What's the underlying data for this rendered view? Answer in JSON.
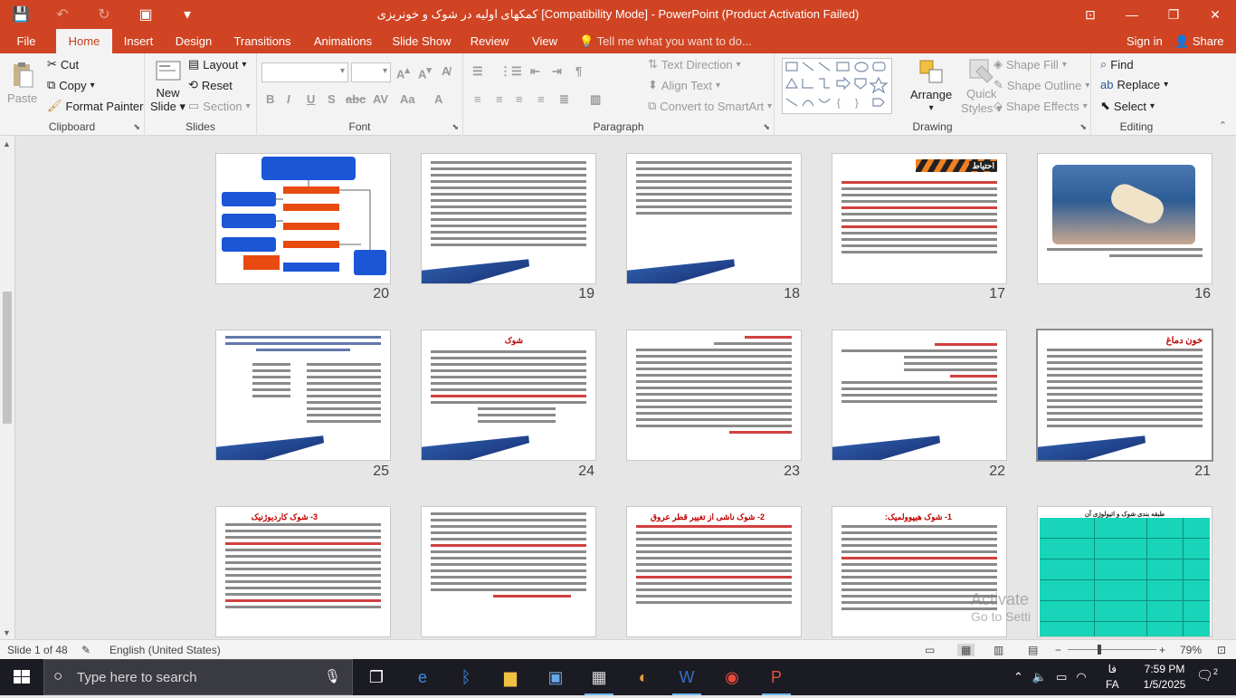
{
  "window": {
    "title": "کمکهای اولیه در شوک و خونریزی [Compatibility Mode] - PowerPoint (Product Activation Failed)"
  },
  "tabs": [
    "File",
    "Home",
    "Insert",
    "Design",
    "Transitions",
    "Animations",
    "Slide Show",
    "Review",
    "View"
  ],
  "active_tab": "Home",
  "tell_me": "Tell me what you want to do...",
  "account": {
    "signin": "Sign in",
    "share": "Share"
  },
  "ribbon": {
    "clipboard": {
      "paste": "Paste",
      "cut": "Cut",
      "copy": "Copy",
      "format_painter": "Format Painter",
      "label": "Clipboard"
    },
    "slides": {
      "new_slide": "New",
      "new_slide_2": "Slide",
      "layout": "Layout",
      "reset": "Reset",
      "section": "Section",
      "label": "Slides"
    },
    "font": {
      "label": "Font"
    },
    "paragraph": {
      "text_direction": "Text Direction",
      "align_text": "Align Text",
      "smartart": "Convert to SmartArt",
      "label": "Paragraph"
    },
    "drawing": {
      "arrange": "Arrange",
      "quick_styles": "Quick",
      "quick_styles_2": "Styles",
      "shape_fill": "Shape Fill",
      "shape_outline": "Shape Outline",
      "shape_effects": "Shape Effects",
      "label": "Drawing"
    },
    "editing": {
      "find": "Find",
      "replace": "Replace",
      "select": "Select",
      "label": "Editing"
    }
  },
  "slides": [
    {
      "num": "16",
      "title": ""
    },
    {
      "num": "17",
      "title": "احتیاط"
    },
    {
      "num": "18",
      "title": ""
    },
    {
      "num": "19",
      "title": ""
    },
    {
      "num": "20",
      "title": ""
    },
    {
      "num": "21",
      "title": "خون دماغ"
    },
    {
      "num": "22",
      "title": ""
    },
    {
      "num": "23",
      "title": ""
    },
    {
      "num": "24",
      "title": "شوک"
    },
    {
      "num": "25",
      "title": ""
    },
    {
      "num": "",
      "title": "طبقه بندی شوک و اتیولوژی آن"
    },
    {
      "num": "",
      "title": "1- شوک هیپوولمیک:"
    },
    {
      "num": "",
      "title": "2- شوک ناشی از تغییر قطر عروق"
    },
    {
      "num": "",
      "title": ""
    },
    {
      "num": "",
      "title": "3- شوک کاردیوژنیک"
    }
  ],
  "watermark": {
    "line1": "Activate",
    "line2": "Go to Setti"
  },
  "status": {
    "slide_of": "Slide 1 of 48",
    "language": "English (United States)",
    "zoom": "79%"
  },
  "taskbar": {
    "search_placeholder": "Type here to search",
    "lang": "فا",
    "lang2": "FA",
    "time": "7:59 PM",
    "date": "1/5/2025",
    "notifications": "2"
  }
}
